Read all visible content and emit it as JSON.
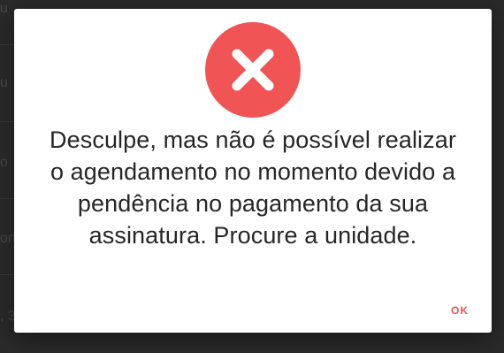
{
  "backdrop": {
    "fragments": [
      "u",
      "u",
      "o",
      "on",
      ", 3"
    ]
  },
  "dialog": {
    "icon": "close-icon",
    "icon_color": "#f05454",
    "message": "Desculpe, mas não é possível realizar o agendamento no momento devido a pendência no pagamento da sua assinatura. Procure a unidade.",
    "ok_label": "OK"
  }
}
